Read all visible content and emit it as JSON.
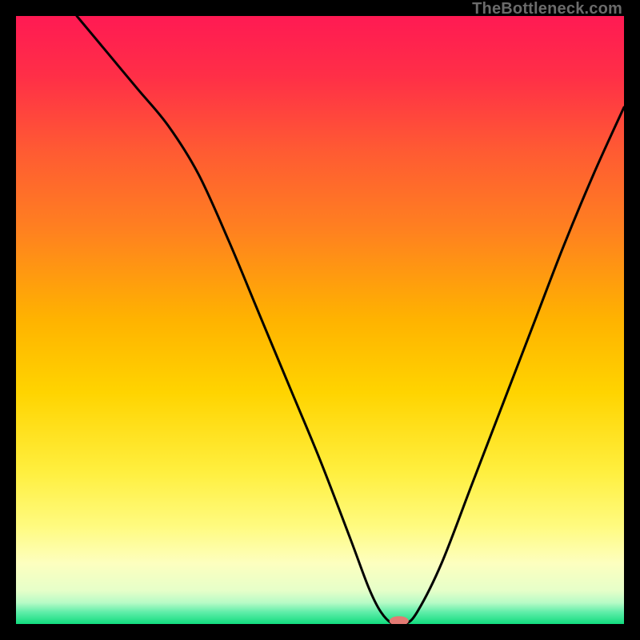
{
  "attribution": "TheBottleneck.com",
  "chart_data": {
    "type": "line",
    "title": "",
    "xlabel": "",
    "ylabel": "",
    "xlim": [
      0,
      100
    ],
    "ylim": [
      0,
      100
    ],
    "grid": false,
    "legend": false,
    "gradient_stops": [
      {
        "t": 0.0,
        "color": "#ff1a53"
      },
      {
        "t": 0.1,
        "color": "#ff2f47"
      },
      {
        "t": 0.22,
        "color": "#ff5a33"
      },
      {
        "t": 0.35,
        "color": "#ff8020"
      },
      {
        "t": 0.5,
        "color": "#ffb300"
      },
      {
        "t": 0.62,
        "color": "#ffd400"
      },
      {
        "t": 0.75,
        "color": "#ffef3f"
      },
      {
        "t": 0.84,
        "color": "#fffb80"
      },
      {
        "t": 0.9,
        "color": "#fdffbf"
      },
      {
        "t": 0.945,
        "color": "#e6ffc9"
      },
      {
        "t": 0.965,
        "color": "#b7fbc6"
      },
      {
        "t": 0.98,
        "color": "#62eeaa"
      },
      {
        "t": 1.0,
        "color": "#11dc7e"
      }
    ],
    "curve": {
      "x": [
        10,
        15,
        20,
        25,
        30,
        35,
        40,
        45,
        50,
        55,
        58,
        60,
        62,
        64,
        66,
        70,
        75,
        80,
        85,
        90,
        95,
        100
      ],
      "y": [
        100,
        94,
        88,
        82,
        74,
        63,
        51,
        39,
        27,
        14,
        6,
        2,
        0,
        0,
        2,
        10,
        23,
        36,
        49,
        62,
        74,
        85
      ]
    },
    "marker": {
      "x": 63,
      "y": 0.5,
      "color": "#e37a73",
      "rx": 12,
      "ry": 6
    }
  }
}
